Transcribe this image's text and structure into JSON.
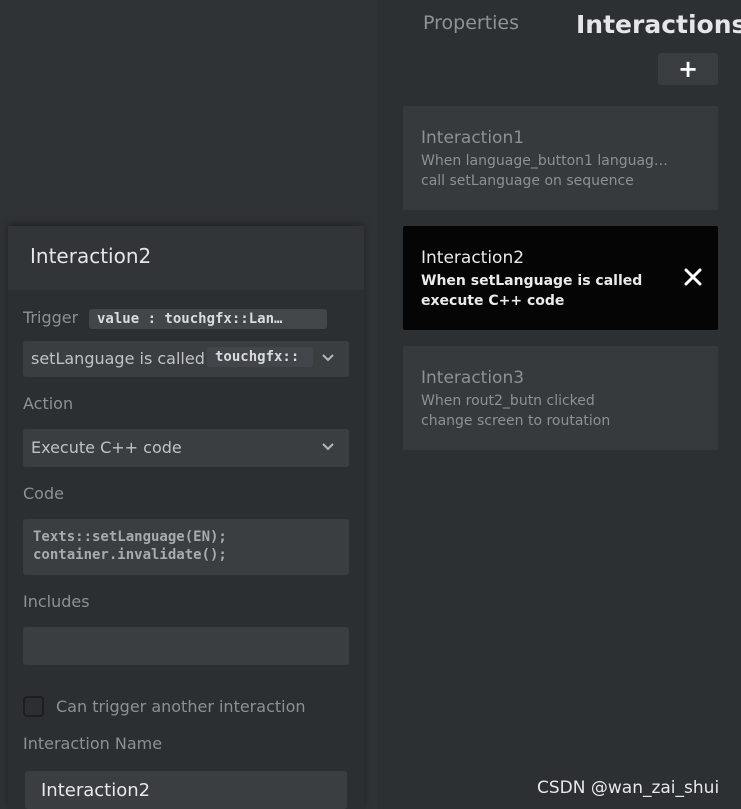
{
  "tabs": {
    "properties": "Properties",
    "interactions": "Interactions"
  },
  "add_button": "+",
  "interactions": [
    {
      "title": "Interaction1",
      "line1": "When language_button1 languag…",
      "line2": "call setLanguage on sequence"
    },
    {
      "title": "Interaction2",
      "line1": "When setLanguage is called",
      "line2": "execute C++ code"
    },
    {
      "title": "Interaction3",
      "line1": "When rout2_butn clicked",
      "line2": "change screen to routation"
    }
  ],
  "editor": {
    "title": "Interaction2",
    "trigger_label": "Trigger",
    "trigger_param": "value : touchgfx::Lan…",
    "trigger_value": "setLanguage is called",
    "trigger_type": "touchgfx::",
    "action_label": "Action",
    "action_value": "Execute C++ code",
    "code_label": "Code",
    "code_lines": [
      "Texts::setLanguage(EN);",
      "container.invalidate();"
    ],
    "includes_label": "Includes",
    "includes_value": "",
    "can_trigger_label": "Can trigger another interaction",
    "can_trigger_checked": false,
    "name_label": "Interaction Name",
    "name_value": "Interaction2"
  },
  "watermark": "CSDN @wan_zai_shui"
}
